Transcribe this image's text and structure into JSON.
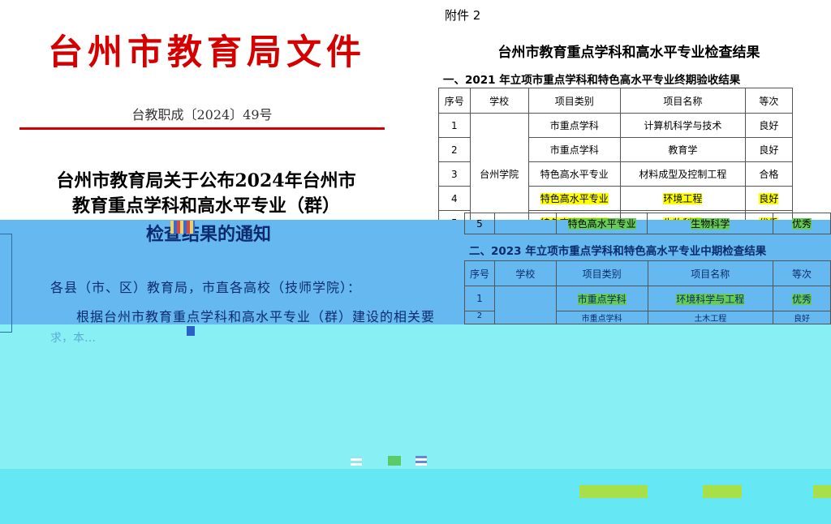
{
  "document": {
    "header": "台州市教育局文件",
    "number": "台教职成〔2024〕49号",
    "title_lines": [
      "台州市教育局关于公布2024年台州市",
      "教育重点学科和高水平专业（群）",
      "检查结果的通知"
    ],
    "salutation": "各县（市、区）教育局，市直各高校（技师学院）：",
    "body_line1": "根据台州市教育重点学科和高水平专业（群）建设的相关要",
    "body_fragment": "求，本…"
  },
  "attachment": {
    "label": "附件 2",
    "title": "台州市教育重点学科和高水平专业检查结果",
    "section1": {
      "heading": "一、2021 年立项市重点学科和特色高水平专业终期验收结果",
      "headers": [
        "序号",
        "学校",
        "项目类别",
        "项目名称",
        "等次"
      ],
      "school": "台州学院",
      "rows": [
        {
          "no": "1",
          "category": "市重点学科",
          "name": "计算机科学与技术",
          "grade": "良好"
        },
        {
          "no": "2",
          "category": "市重点学科",
          "name": "教育学",
          "grade": "良好"
        },
        {
          "no": "3",
          "category": "特色高水平专业",
          "name": "材料成型及控制工程",
          "grade": "合格"
        },
        {
          "no": "4",
          "category": "特色高水平专业",
          "name": "环境工程",
          "grade": "良好"
        },
        {
          "no": "5",
          "category": "特色高水平专业",
          "name": "生物科学",
          "grade": "优秀"
        }
      ]
    },
    "section2": {
      "heading": "二、2023 年立项市重点学科和特色高水平专业中期检查结果",
      "headers": [
        "序号",
        "学校",
        "项目类别",
        "项目名称",
        "等次"
      ],
      "rows": [
        {
          "no": "1",
          "category": "市重点学科",
          "name": "环境科学与工程",
          "grade": "优秀"
        },
        {
          "no": "2",
          "category": "市重点学科",
          "name": "土木工程",
          "grade": "良好"
        }
      ]
    }
  },
  "colors": {
    "red": "#d40000",
    "blue_band": "#66b9f0",
    "cyan_band": "#88f0f4",
    "highlight_yellow": "#ffff00",
    "highlight_green": "#66cc55"
  }
}
